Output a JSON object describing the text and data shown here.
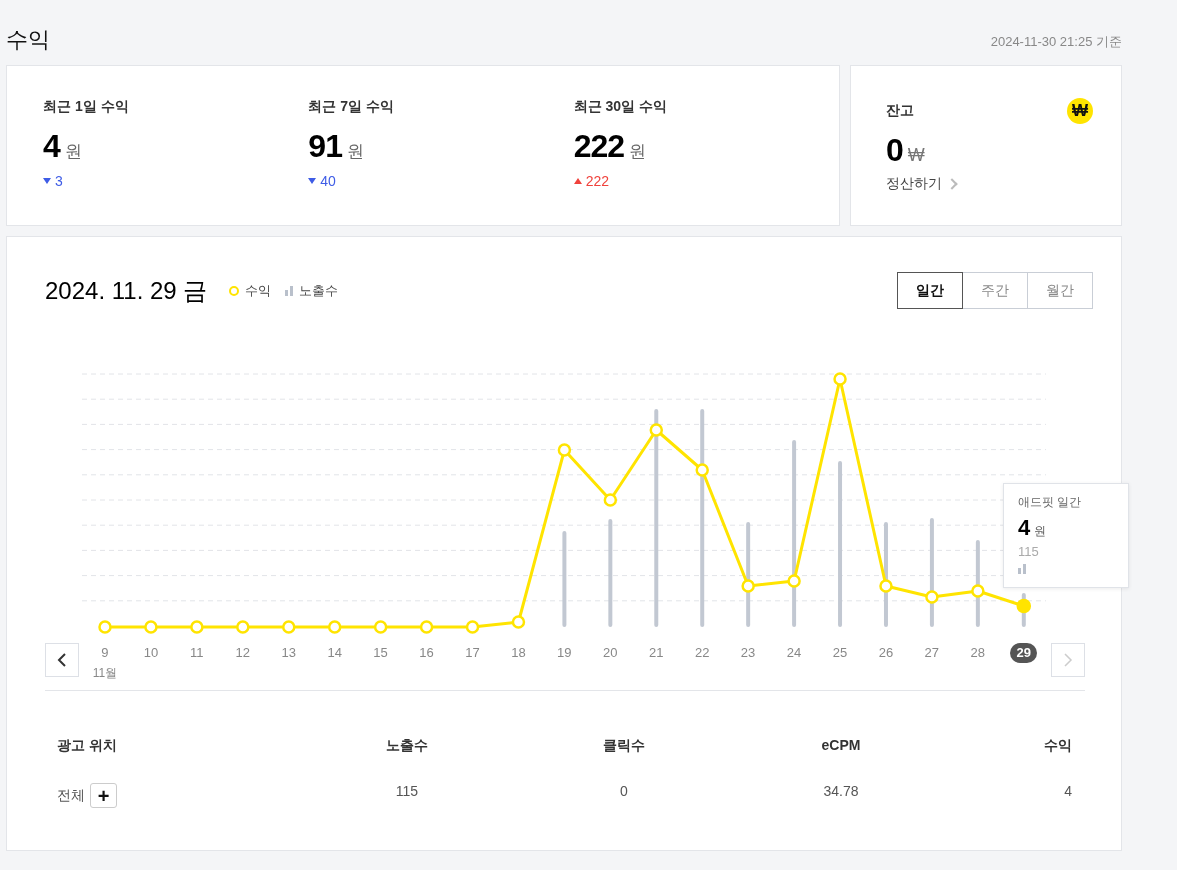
{
  "page": {
    "title": "수익",
    "updated_at": "2024-11-30 21:25 기준"
  },
  "summary": [
    {
      "label": "최근 1일 수익",
      "value": "4",
      "unit": "원",
      "change": "3",
      "increased": false
    },
    {
      "label": "최근 7일 수익",
      "value": "91",
      "unit": "원",
      "change": "40",
      "increased": false
    },
    {
      "label": "최근 30일 수익",
      "value": "222",
      "unit": "원",
      "change": "222",
      "increased": true
    }
  ],
  "balance": {
    "label": "잔고",
    "coin_symbol": "₩",
    "value": "0",
    "unit": "₩",
    "link": "정산하기"
  },
  "chart_panel": {
    "date": "2024. 11. 29 금",
    "legend": [
      {
        "label": "수익",
        "kind": "line"
      },
      {
        "label": "노출수",
        "kind": "bar"
      }
    ],
    "periods": [
      {
        "label": "일간",
        "selected": true
      },
      {
        "label": "주간",
        "selected": false
      },
      {
        "label": "월간",
        "selected": false
      }
    ],
    "x_labels": [
      {
        "label": "9",
        "selected": false
      },
      {
        "label": "10",
        "selected": false
      },
      {
        "label": "11",
        "selected": false
      },
      {
        "label": "12",
        "selected": false
      },
      {
        "label": "13",
        "selected": false
      },
      {
        "label": "14",
        "selected": false
      },
      {
        "label": "15",
        "selected": false
      },
      {
        "label": "16",
        "selected": false
      },
      {
        "label": "17",
        "selected": false
      },
      {
        "label": "18",
        "selected": false
      },
      {
        "label": "19",
        "selected": false
      },
      {
        "label": "20",
        "selected": false
      },
      {
        "label": "21",
        "selected": false
      },
      {
        "label": "22",
        "selected": false
      },
      {
        "label": "23",
        "selected": false
      },
      {
        "label": "24",
        "selected": false
      },
      {
        "label": "25",
        "selected": false
      },
      {
        "label": "26",
        "selected": false
      },
      {
        "label": "27",
        "selected": false
      },
      {
        "label": "28",
        "selected": false
      },
      {
        "label": "29",
        "selected": true
      }
    ],
    "month_label": "11월",
    "tooltip": {
      "title": "애드핏 일간",
      "value": "4",
      "unit": "원",
      "impressions": "115"
    }
  },
  "table": {
    "columns": [
      "광고 위치",
      "노출수",
      "클릭수",
      "eCPM",
      "수익"
    ],
    "rows": [
      {
        "cells": [
          "전체",
          "115",
          "0",
          "34.78",
          "4"
        ],
        "expand_symbol": "+"
      }
    ]
  }
}
